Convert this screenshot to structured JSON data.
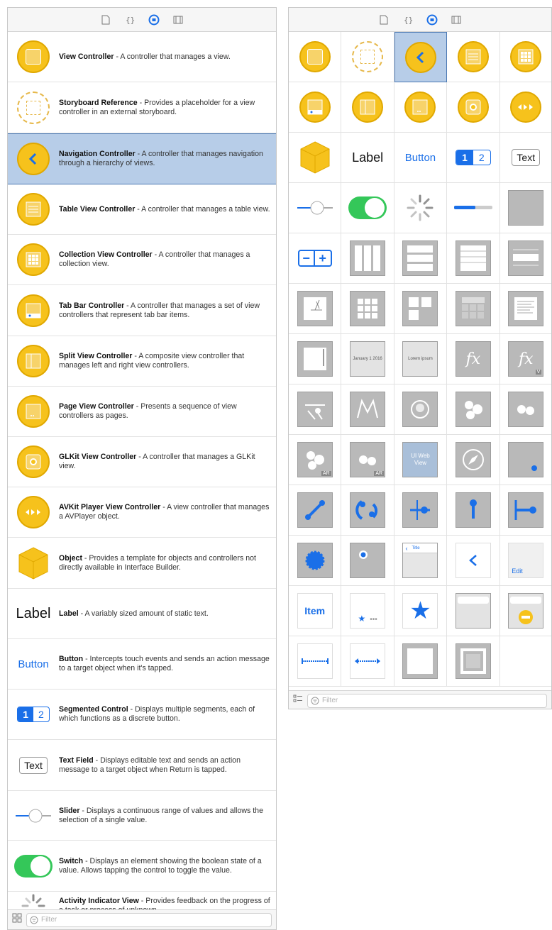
{
  "left_filter_placeholder": "Filter",
  "right_filter_placeholder": "Filter",
  "items": [
    {
      "title": "View Controller",
      "desc": " - A controller that manages a view."
    },
    {
      "title": "Storyboard Reference",
      "desc": " - Provides a placeholder for a view controller in an external storyboard."
    },
    {
      "title": "Navigation Controller",
      "desc": " - A controller that manages navigation through a hierarchy of views."
    },
    {
      "title": "Table View Controller",
      "desc": " - A controller that manages a table view."
    },
    {
      "title": "Collection View Controller",
      "desc": " - A controller that manages a collection view."
    },
    {
      "title": "Tab Bar Controller",
      "desc": " - A controller that manages a set of view controllers that represent tab bar items."
    },
    {
      "title": "Split View Controller",
      "desc": " - A composite view controller that manages left and right view controllers."
    },
    {
      "title": "Page View Controller",
      "desc": " - Presents a sequence of view controllers as pages."
    },
    {
      "title": "GLKit View Controller",
      "desc": " - A controller that manages a GLKit view."
    },
    {
      "title": "AVKit Player View Controller",
      "desc": " - A view controller that manages a AVPlayer object."
    },
    {
      "title": "Object",
      "desc": " - Provides a template for objects and controllers not directly available in Interface Builder."
    },
    {
      "title": "Label",
      "desc": " - A variably sized amount of static text."
    },
    {
      "title": "Button",
      "desc": " - Intercepts touch events and sends an action message to a target object when it's tapped."
    },
    {
      "title": "Segmented Control",
      "desc": " - Displays multiple segments, each of which functions as a discrete button."
    },
    {
      "title": "Text Field",
      "desc": " - Displays editable text and sends an action message to a target object when Return is tapped."
    },
    {
      "title": "Slider",
      "desc": " - Displays a continuous range of values and allows the selection of a single value."
    },
    {
      "title": "Switch",
      "desc": " - Displays an element showing the boolean state of a value. Allows tapping the control to toggle the value."
    },
    {
      "title": "Activity Indicator View",
      "desc": " - Provides feedback on the progress of a task or process of unknown..."
    }
  ],
  "icon_texts": {
    "label": "Label",
    "button": "Button",
    "seg1": "1",
    "seg2": "2",
    "text": "Text",
    "item": "Item",
    "edit": "Edit",
    "title": "Title",
    "lorem": "Lorem ipsum",
    "date": "January 1 2016",
    "webview": "UI Web View",
    "fx": "fx",
    "ar": "AR",
    "v": "V"
  },
  "colors": {
    "accent": "#1a6fe8",
    "yellow": "#f6c21c",
    "selection": "#b7cde8",
    "switch_green": "#34c759"
  }
}
